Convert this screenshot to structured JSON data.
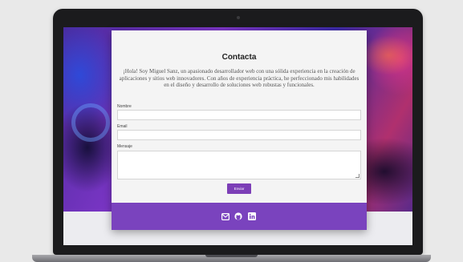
{
  "contact": {
    "title": "Contacta",
    "intro": "¡Hola! Soy Miguel Sanz, un apasionado desarrollador web con una sólida experiencia en la creación de aplicaciones y sitios web innovadores. Con años de experiencia práctica, he perfeccionado mis habilidades en el diseño y desarrollo de soluciones web robustas y funcionales.",
    "fields": {
      "name_label": "Nombre",
      "email_label": "Email",
      "message_label": "Mensaje"
    },
    "send_label": "Enviar"
  },
  "footer": {
    "icons": [
      "email-icon",
      "github-icon",
      "linkedin-icon"
    ]
  },
  "colors": {
    "accent": "#7a43be",
    "card": "#f4f4f4"
  }
}
